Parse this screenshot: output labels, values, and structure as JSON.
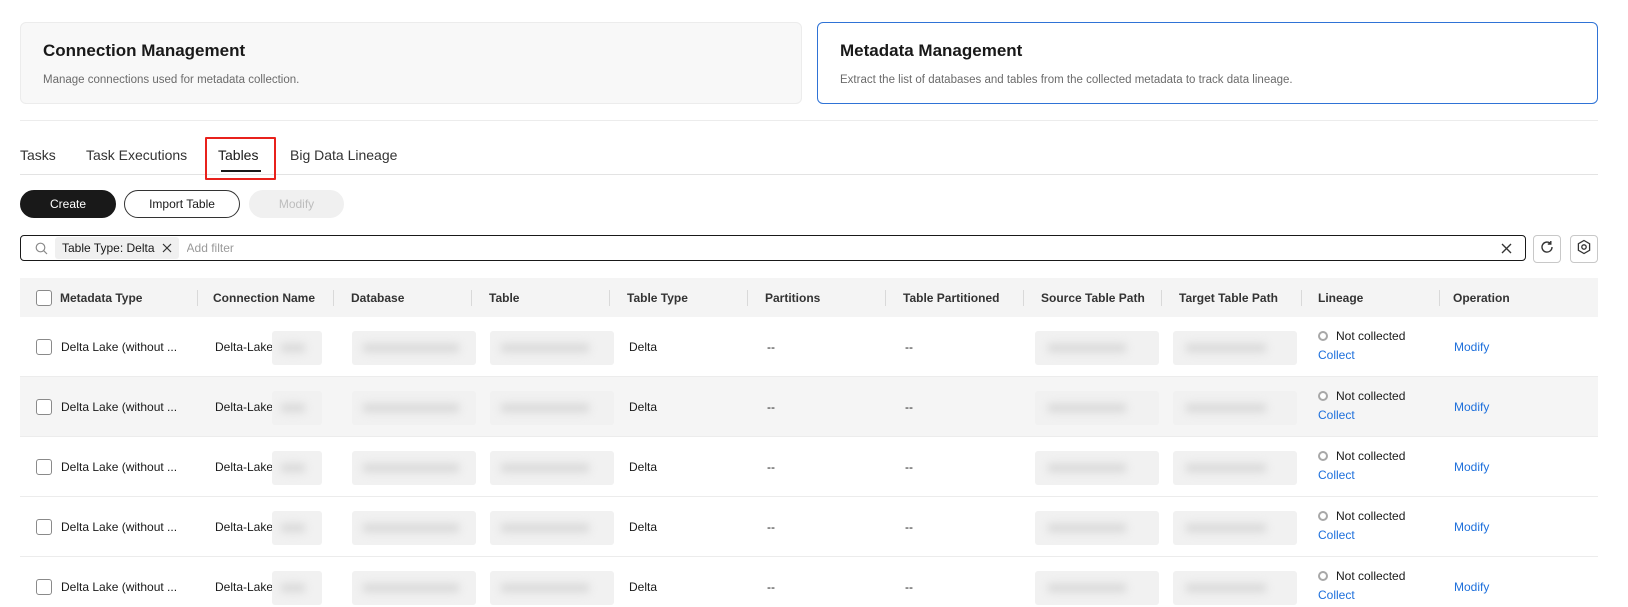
{
  "cards": {
    "connection": {
      "title": "Connection Management",
      "description": "Manage connections used for metadata collection."
    },
    "metadata": {
      "title": "Metadata Management",
      "description": "Extract the list of databases and tables from the collected metadata to track data lineage."
    }
  },
  "tabs": [
    {
      "label": "Tasks"
    },
    {
      "label": "Task Executions"
    },
    {
      "label": "Tables",
      "active": true
    },
    {
      "label": "Big Data Lineage"
    }
  ],
  "toolbar": {
    "create_label": "Create",
    "import_label": "Import Table",
    "modify_label": "Modify"
  },
  "filter": {
    "chip_label": "Table Type: Delta",
    "placeholder": "Add filter"
  },
  "table": {
    "columns": [
      "Metadata Type",
      "Connection Name",
      "Database",
      "Table",
      "Table Type",
      "Partitions",
      "Table Partitioned",
      "Source Table Path",
      "Target Table Path",
      "Lineage",
      "Operation"
    ],
    "rows": [
      {
        "metadata_type": "Delta Lake (without ...",
        "connection_name": "Delta-Lake",
        "table_type": "Delta",
        "partitions": "--",
        "table_partitioned": "--",
        "lineage_status": "Not collected",
        "lineage_action": "Collect",
        "operation": "Modify"
      },
      {
        "metadata_type": "Delta Lake (without ...",
        "connection_name": "Delta-Lake",
        "table_type": "Delta",
        "partitions": "--",
        "table_partitioned": "--",
        "lineage_status": "Not collected",
        "lineage_action": "Collect",
        "operation": "Modify"
      },
      {
        "metadata_type": "Delta Lake (without ...",
        "connection_name": "Delta-Lake",
        "table_type": "Delta",
        "partitions": "--",
        "table_partitioned": "--",
        "lineage_status": "Not collected",
        "lineage_action": "Collect",
        "operation": "Modify"
      },
      {
        "metadata_type": "Delta Lake (without ...",
        "connection_name": "Delta-Lake",
        "table_type": "Delta",
        "partitions": "--",
        "table_partitioned": "--",
        "lineage_status": "Not collected",
        "lineage_action": "Collect",
        "operation": "Modify"
      },
      {
        "metadata_type": "Delta Lake (without ...",
        "connection_name": "Delta-Lake",
        "table_type": "Delta",
        "partitions": "--",
        "table_partitioned": "--",
        "lineage_status": "Not collected",
        "lineage_action": "Collect",
        "operation": "Modify"
      }
    ]
  },
  "colors": {
    "accent_link": "#1d6fdb",
    "active_card_border": "#2f73d6",
    "highlight": "#e8211c"
  },
  "icons": {
    "search": "search-icon",
    "chip_close": "close-icon",
    "clear": "clear-icon",
    "refresh": "refresh-icon",
    "settings": "gear-icon"
  }
}
